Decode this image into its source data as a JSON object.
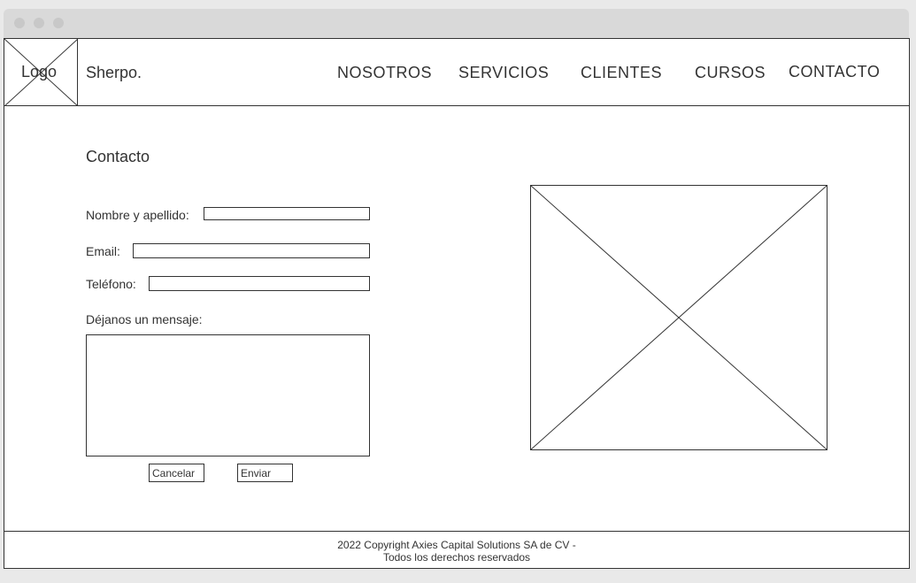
{
  "header": {
    "logo_label": "Logo",
    "brand": "Sherpo.",
    "nav": [
      "NOSOTROS",
      "SERVICIOS",
      "CLIENTES",
      "CURSOS",
      "CONTACTO"
    ]
  },
  "contact": {
    "title": "Contacto",
    "name_label": "Nombre y apellido:",
    "email_label": "Email:",
    "phone_label": "Teléfono:",
    "message_label": "Déjanos un mensaje:",
    "name_value": "",
    "email_value": "",
    "phone_value": "",
    "message_value": "",
    "cancel_label": "Cancelar",
    "send_label": "Enviar"
  },
  "footer": {
    "line1": "2022 Copyright Axies Capital Solutions SA de CV -",
    "line2": "Todos los derechos reservados"
  }
}
